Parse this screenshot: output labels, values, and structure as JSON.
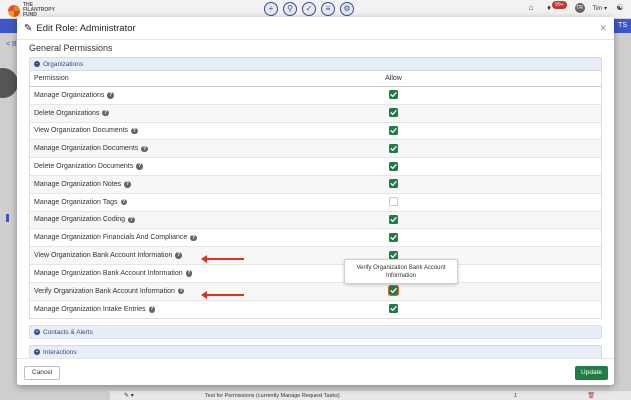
{
  "app": {
    "logo_text": "THE FILANTROPY FUND",
    "user_name": "Tim",
    "notifications_count": "99+",
    "user_initials": "TR",
    "blue_bar_text": "TS",
    "back_text": "< B"
  },
  "modal": {
    "title": "Edit Role: Administrator",
    "section_title": "General Permissions",
    "columns": {
      "permission": "Permission",
      "allow": "Allow"
    },
    "groups": [
      {
        "name": "Organizations",
        "expanded": true,
        "rows": [
          {
            "label": "Manage Organizations",
            "allowed": true
          },
          {
            "label": "Delete Organizations",
            "allowed": true
          },
          {
            "label": "View Organization Documents",
            "allowed": true
          },
          {
            "label": "Manage Organization Documents",
            "allowed": true
          },
          {
            "label": "Delete Organization Documents",
            "allowed": true
          },
          {
            "label": "Manage Organization Notes",
            "allowed": true
          },
          {
            "label": "Manage Organization Tags",
            "allowed": false
          },
          {
            "label": "Manage Organization Coding",
            "allowed": true
          },
          {
            "label": "Manage Organization Financials And Compliance",
            "allowed": true
          },
          {
            "label": "View Organization Bank Account Information",
            "allowed": true
          },
          {
            "label": "Manage Organization Bank Account Information",
            "allowed": true
          },
          {
            "label": "Verify Organization Bank Account Information",
            "allowed": true
          },
          {
            "label": "Manage Organization Intake Entries",
            "allowed": true
          }
        ]
      },
      {
        "name": "Contacts & Alerts",
        "expanded": false
      },
      {
        "name": "Interactions",
        "expanded": false
      }
    ],
    "tooltip": "Verify Organization Bank Account Information",
    "cancel_label": "Cancel",
    "update_label": "Update"
  },
  "background_row": {
    "text": "Test for Permissions (currently Manage Request Tasks)",
    "count": "1"
  },
  "colors": {
    "accent_green": "#1e7e45",
    "accent_blue": "#3e56c9",
    "annotation_red": "#e0301e",
    "focus_orange": "#e25d1e"
  }
}
